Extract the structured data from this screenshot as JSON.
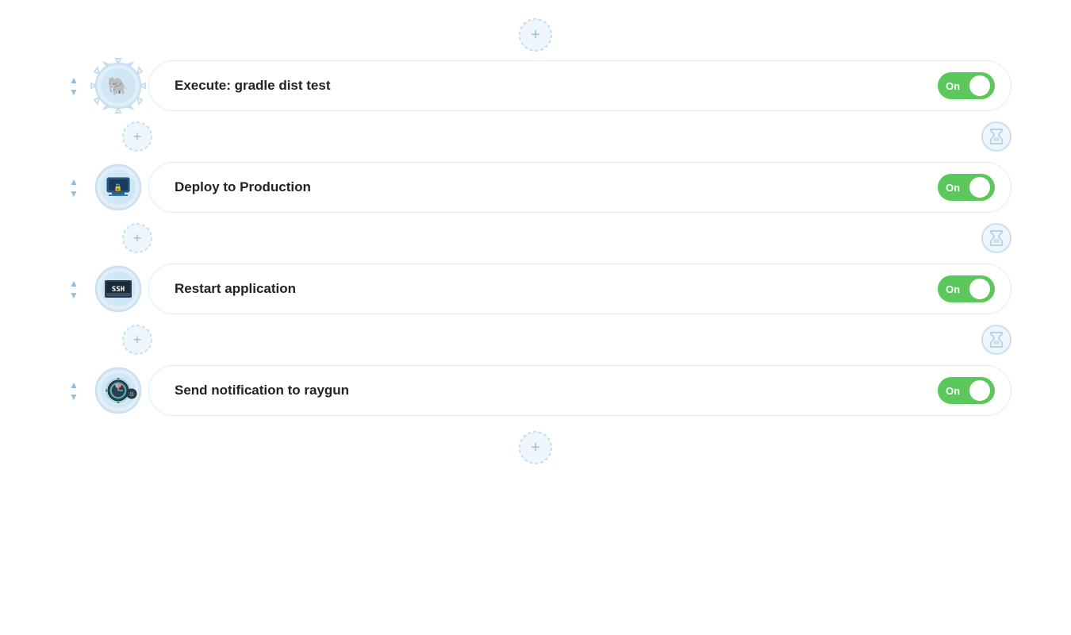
{
  "pipeline": {
    "steps": [
      {
        "id": "step-1",
        "label": "Execute: gradle dist test",
        "icon_type": "elephant",
        "icon_emoji": "🐘",
        "toggle_on": true,
        "toggle_label": "On"
      },
      {
        "id": "step-2",
        "label": "Deploy to Production",
        "icon_type": "deploy",
        "icon_emoji": "🖥",
        "toggle_on": true,
        "toggle_label": "On"
      },
      {
        "id": "step-3",
        "label": "Restart application",
        "icon_type": "ssh",
        "icon_text": "SSH",
        "toggle_on": true,
        "toggle_label": "On"
      },
      {
        "id": "step-4",
        "label": "Send notification to raygun",
        "icon_type": "raygun",
        "icon_emoji": "🎯",
        "toggle_on": true,
        "toggle_label": "On"
      }
    ],
    "toggle_color": "#5ac85a",
    "add_btn_label": "+",
    "hourglass_symbol": "⏳"
  }
}
